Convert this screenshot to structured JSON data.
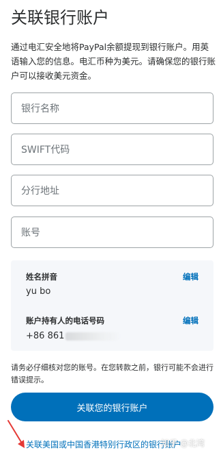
{
  "page": {
    "title": "关联银行账户",
    "intro": "通过电汇安全地将PayPal余额提现到银行账户。用英语输入您的信息。电汇币种为美元。请确保您的银行账户可以接收美元资金。"
  },
  "form": {
    "bank_name_placeholder": "银行名称",
    "swift_placeholder": "SWIFT代码",
    "branch_address_placeholder": "分行地址",
    "account_number_placeholder": "账号"
  },
  "info": {
    "name_label": "姓名拼音",
    "name_value": "yu bo",
    "phone_label": "账户持有人的电话号码",
    "phone_value": "+86 861",
    "edit_label": "编辑"
  },
  "notice": "请务必仔细核对您的账号。在您转款之前，银行可能不会进行错误提示。",
  "buttons": {
    "link_bank": "关联您的银行账户"
  },
  "footer": {
    "alt_link": "关联美国或中国香港特别行政区的银行账户",
    "watermark": "知乎 @北湾"
  },
  "colors": {
    "accent": "#0070ba",
    "annotation_arrow": "#e53935"
  }
}
